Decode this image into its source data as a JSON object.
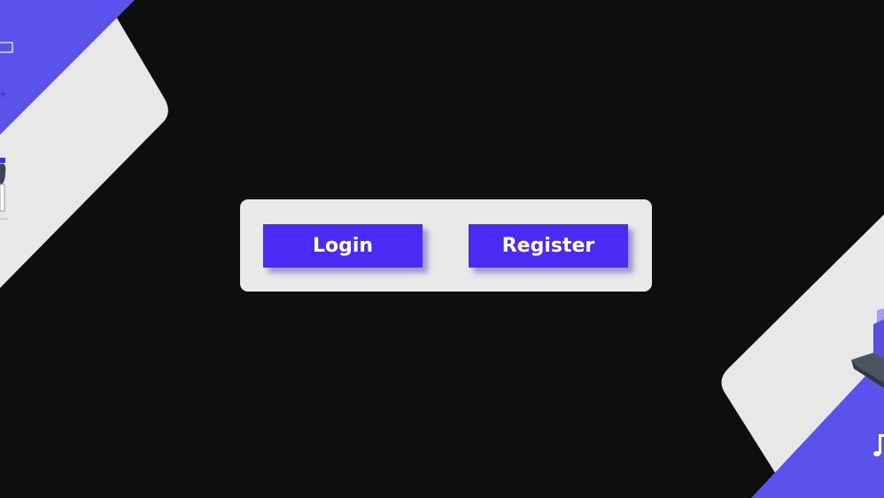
{
  "auth": {
    "login_label": "Login",
    "register_label": "Register"
  },
  "theme": {
    "background": "#0e0e0e",
    "panel": "#e9e9e9",
    "accent": "#4a2af4",
    "decor_purple": "#5b52ee",
    "decor_light": "#e8e8e8"
  },
  "decor": {
    "top_left_icons": [
      "window-icon",
      "sparkle-icon",
      "person-illustration-icon"
    ],
    "bottom_right_icons": [
      "laptop-illustration-icon",
      "music-note-icon"
    ]
  }
}
